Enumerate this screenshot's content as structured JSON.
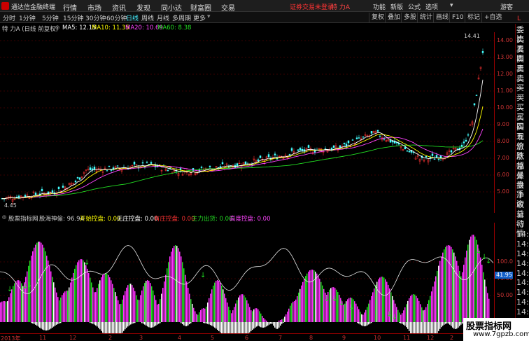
{
  "app": {
    "name": "通达信金融终端",
    "menus": [
      "行情",
      "市场",
      "资讯",
      "发现",
      "同小达",
      "财富圈",
      "交易"
    ],
    "login_status": "证券交易未登录",
    "stock_header": "特 力A",
    "right_menus": [
      "功能",
      "新版",
      "公式",
      "选项"
    ],
    "guest": "游客"
  },
  "toolbar": {
    "periods": [
      "分时",
      "1分钟",
      "5分钟",
      "15分钟",
      "30分钟",
      "60分钟",
      "日线",
      "周线",
      "月线",
      "多周期",
      "更多"
    ],
    "active_period": "日线",
    "buttons": [
      "复权",
      "叠加",
      "多股",
      "统计",
      "画线",
      "F10",
      "标记",
      "+自选"
    ]
  },
  "info": {
    "stock_label": "特 力A (日线 前复权)",
    "ma5": "MA5: 12.15",
    "ma10": "MA10: 11.35",
    "ma20": "MA20: 10.69",
    "ma60": "MA60: 8.38",
    "high_marker": "14.41",
    "low_marker": "4.45"
  },
  "colors": {
    "ma5": "#ffffff",
    "ma10": "#ffff00",
    "ma20": "#ff44ff",
    "ma60": "#22dd22",
    "up": "#ff3333",
    "down": "#44ffff",
    "axis": "#cc3333"
  },
  "price_axis": [
    "14.00",
    "13.00",
    "12.00",
    "11.00",
    "10.00",
    "9.00",
    "8.00",
    "7.00",
    "6.00",
    "5.00"
  ],
  "indicator": {
    "tab": "股票指标网",
    "name": "股海神偷: 96.94",
    "items": [
      {
        "label": "开始控盘: 0.00",
        "color": "#ffff00"
      },
      {
        "label": "无庄控盘: 0.00",
        "color": "#ffffff"
      },
      {
        "label": "有庄控盘: 0.00",
        "color": "#ff3333"
      },
      {
        "label": "主力出货: 0.00",
        "color": "#22dd22"
      },
      {
        "label": "高度控盘: 0.00",
        "color": "#ff44ff"
      }
    ],
    "axis": [
      "100.0",
      "75.00",
      "50.00"
    ],
    "current": "41.95"
  },
  "right_panel": [
    "委比",
    "卖五",
    "卖四",
    "卖三",
    "卖二",
    "卖一",
    "买一",
    "买二",
    "买三",
    "买四",
    "买五",
    "现价",
    "涨跌",
    "涨幅",
    "总量",
    "外盘",
    "换手",
    "净资",
    "收益",
    "自动",
    "行情",
    "14:5",
    "14:5",
    "14:5",
    "14:5",
    "14:5",
    "14:5",
    "14:5",
    "14:5",
    "14:5",
    "14:5"
  ],
  "right_panel_header": "L",
  "dates": [
    "2013年",
    "11",
    "12",
    "2",
    "3",
    "4",
    "5",
    "6",
    "7",
    "8",
    "9",
    "10",
    "11",
    "12",
    "2"
  ],
  "watermark": {
    "line1": "股票指标网",
    "line2": "www.7gpzb.com"
  }
}
